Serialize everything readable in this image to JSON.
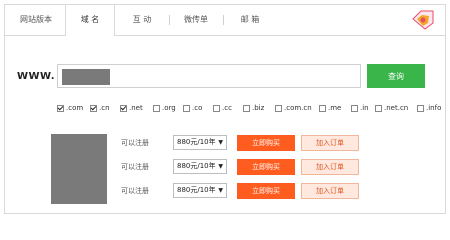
{
  "tabs": [
    {
      "label": "网站版本",
      "active": false
    },
    {
      "label": "域 名",
      "active": true
    },
    {
      "label": "互 动",
      "active": false
    },
    {
      "label": "微传单",
      "active": false
    },
    {
      "label": "邮 箱",
      "active": false
    }
  ],
  "search": {
    "prefix": "WWW.",
    "value": "",
    "button_label": "查询"
  },
  "tlds": [
    {
      "label": ".com",
      "checked": true
    },
    {
      "label": ".cn",
      "checked": true
    },
    {
      "label": ".net",
      "checked": true
    },
    {
      "label": ".org",
      "checked": false
    },
    {
      "label": ".co",
      "checked": false
    },
    {
      "label": ".cc",
      "checked": false
    },
    {
      "label": ".biz",
      "checked": false
    },
    {
      "label": ".com.cn",
      "checked": false
    },
    {
      "label": ".me",
      "checked": false
    },
    {
      "label": ".in",
      "checked": false
    },
    {
      "label": ".net.cn",
      "checked": false
    },
    {
      "label": ".info",
      "checked": false
    }
  ],
  "results": [
    {
      "status": "可以注册",
      "price": "880元/10年",
      "buy_label": "立即购买",
      "cart_label": "加入订单"
    },
    {
      "status": "可以注册",
      "price": "880元/10年",
      "buy_label": "立即购买",
      "cart_label": "加入订单"
    },
    {
      "status": "可以注册",
      "price": "880元/10年",
      "buy_label": "立即购买",
      "cart_label": "加入订单"
    }
  ],
  "colors": {
    "query_button": "#39b54a",
    "buy_button": "#ff5c1f",
    "cart_button_bg": "#ffe9de",
    "redacted": "#7a7a7a"
  }
}
